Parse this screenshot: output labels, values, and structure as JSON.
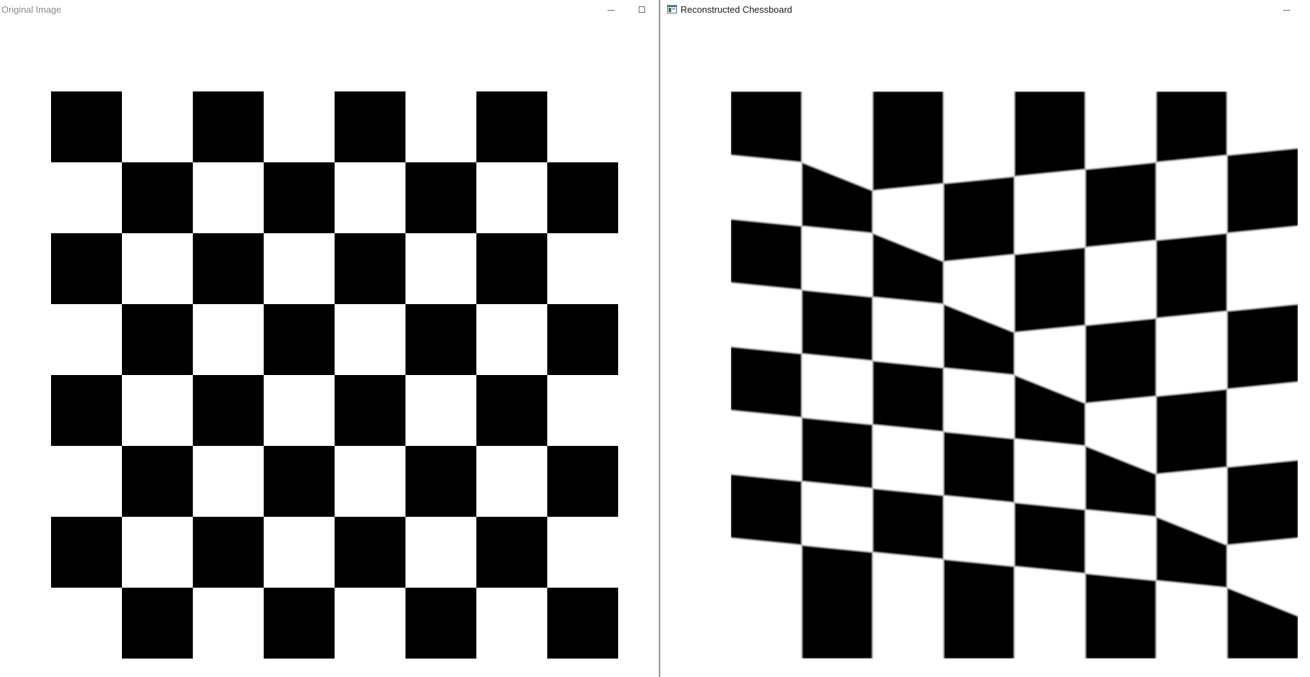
{
  "windows": {
    "left": {
      "title": "Original Image"
    },
    "right": {
      "title": "Reconstructed Chessboard"
    }
  },
  "board": {
    "columns": 8,
    "rows": 8,
    "dark_color": "#000000",
    "light_color": "#ffffff",
    "first_square": "dark"
  },
  "colors": {
    "window_background": "#ffffff",
    "separator": "#7a7a7a",
    "inactive_title_text": "#8c8c8c",
    "active_title_text": "#1a1a1a"
  },
  "icons": {
    "left_controls": [
      "minimize-icon",
      "maximize-icon"
    ],
    "right_controls": [
      "minimize-icon"
    ],
    "right_app_icon": "app-window-icon"
  }
}
